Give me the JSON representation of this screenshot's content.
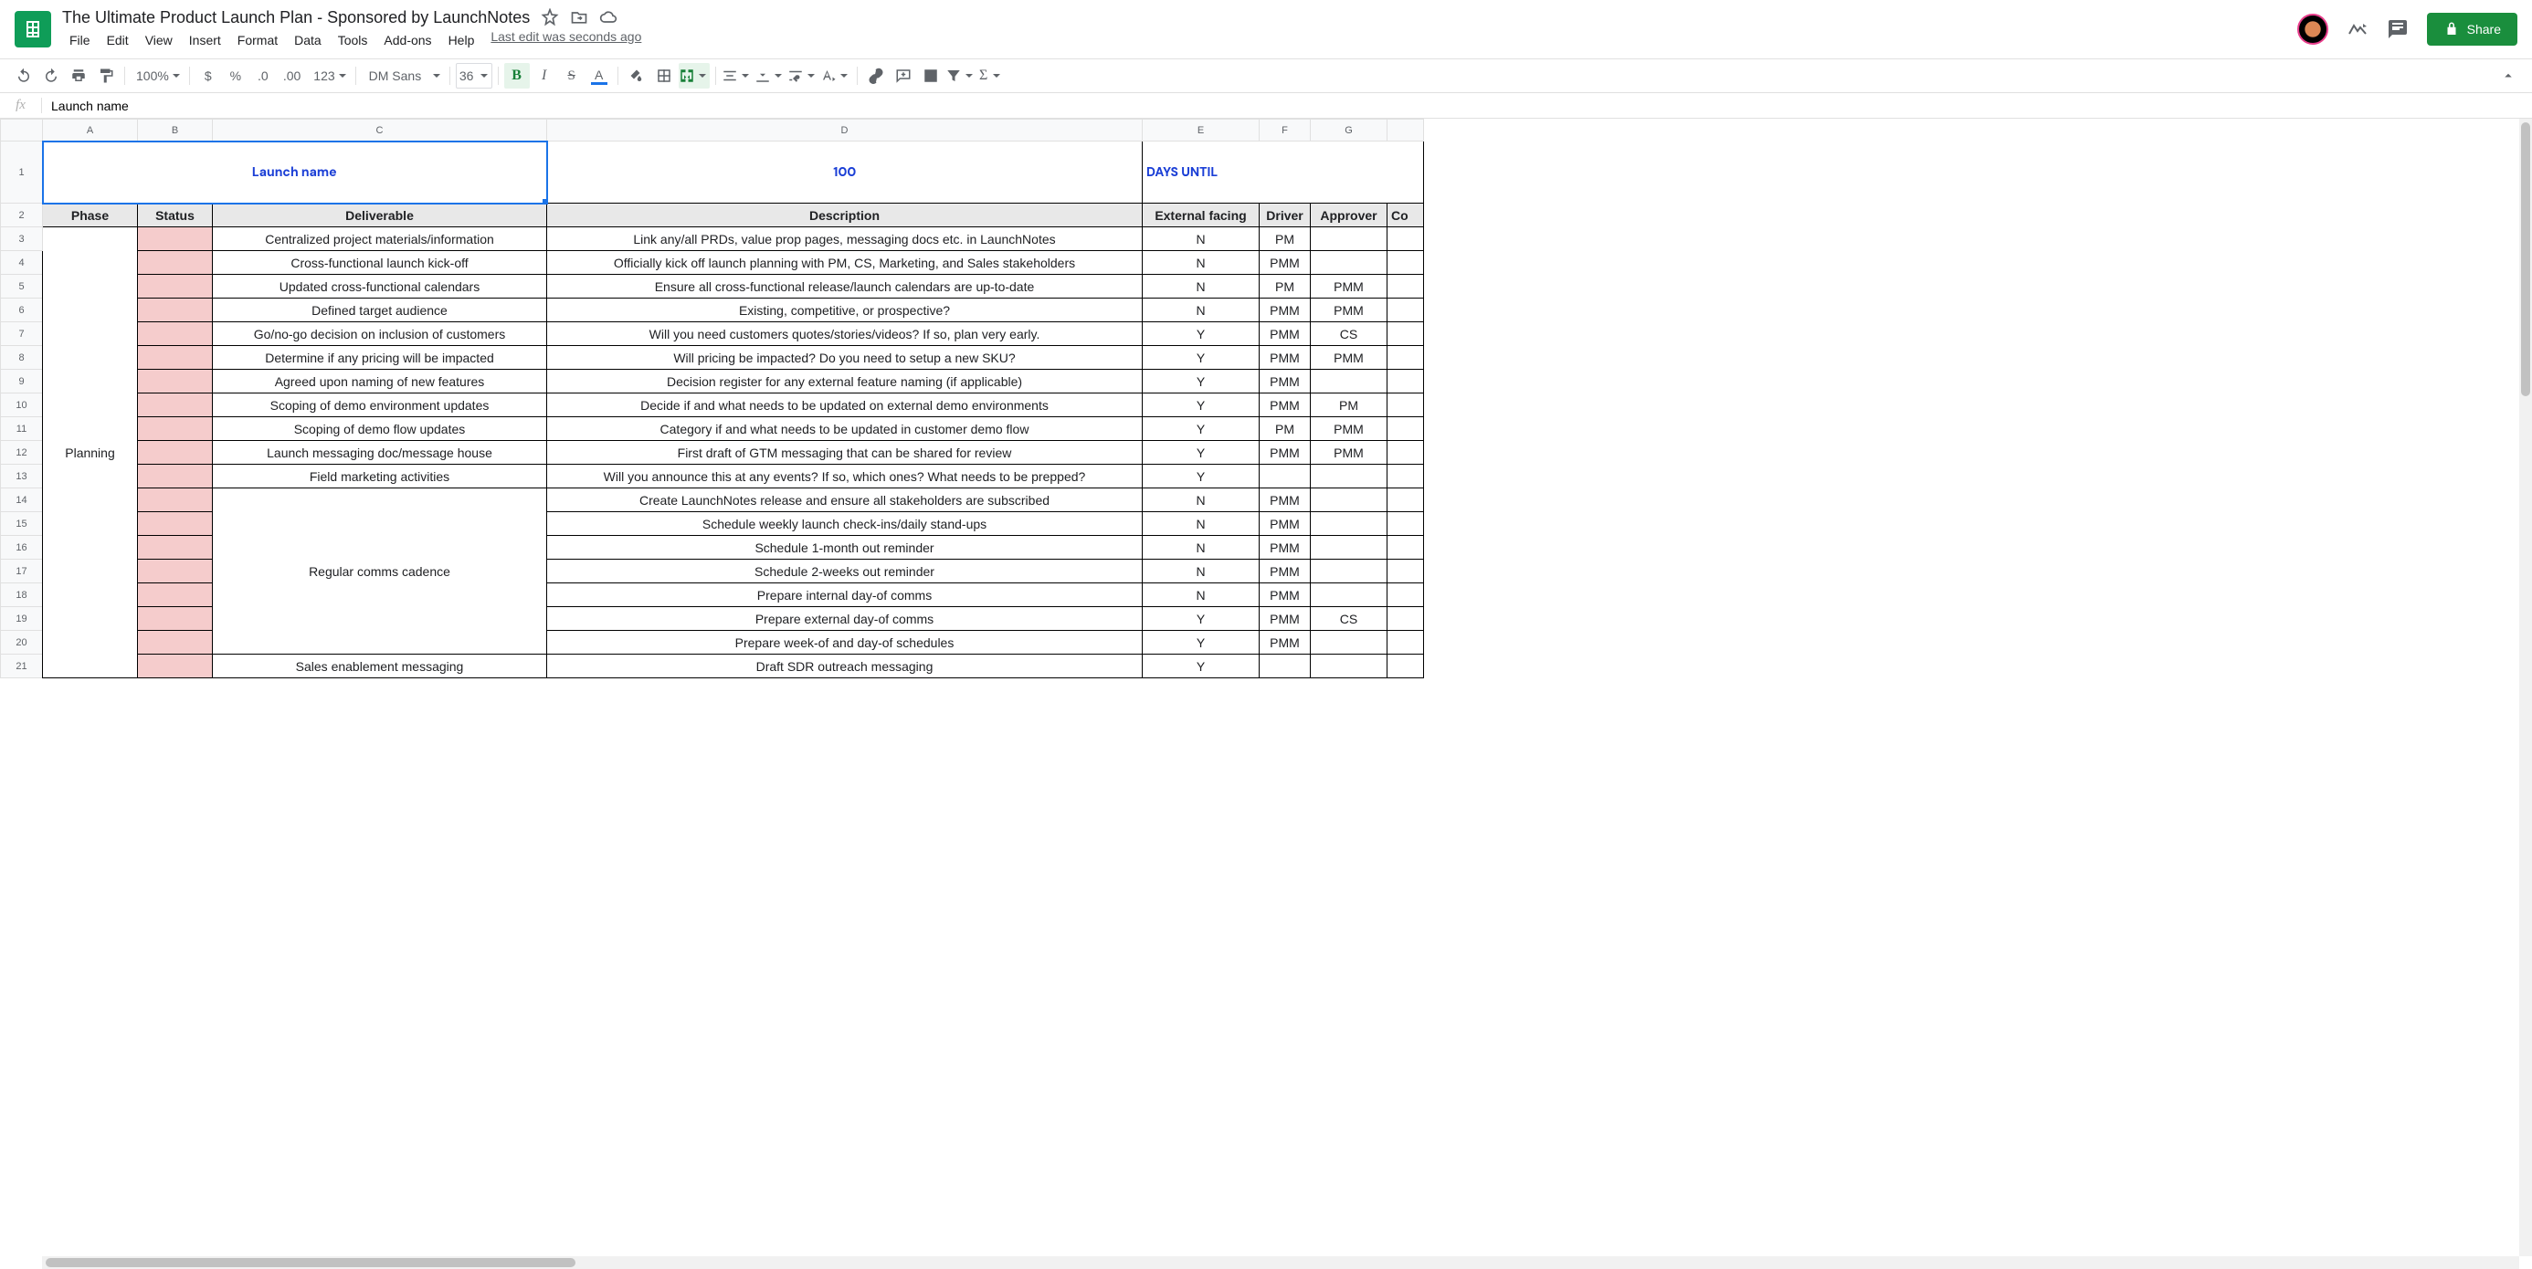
{
  "doc": {
    "title": "The Ultimate Product Launch Plan - Sponsored by LaunchNotes",
    "last_edit": "Last edit was seconds ago",
    "share": "Share"
  },
  "menu": [
    "File",
    "Edit",
    "View",
    "Insert",
    "Format",
    "Data",
    "Tools",
    "Add-ons",
    "Help"
  ],
  "toolbar": {
    "zoom": "100%",
    "currency": "$",
    "percent": "%",
    "dec_dec": ".0",
    "dec_inc": ".00",
    "numfmt": "123",
    "font": "DM Sans",
    "size": "36",
    "bold": "B",
    "italic": "I",
    "strike": "S",
    "textcolor_letter": "A",
    "sigma": "Σ"
  },
  "fx": {
    "value": "Launch name"
  },
  "columns": [
    "A",
    "B",
    "C",
    "D",
    "E",
    "F",
    "G"
  ],
  "row1": {
    "title": "Launch name",
    "days_value": "100",
    "days_label": "DAYS UNTIL"
  },
  "headers": {
    "phase": "Phase",
    "status": "Status",
    "deliverable": "Deliverable",
    "description": "Description",
    "external": "External facing",
    "driver": "Driver",
    "approver": "Approver",
    "co": "Co"
  },
  "phase_planning": "Planning",
  "reg_comms": "Regular comms cadence",
  "sales_enable": "Sales enablement messaging",
  "rows": [
    {
      "n": 3,
      "c": "Centralized project materials/information",
      "d": "Link any/all PRDs, value prop pages, messaging docs etc. in LaunchNotes",
      "e": "N",
      "f": "PM",
      "g": ""
    },
    {
      "n": 4,
      "c": "Cross-functional launch kick-off",
      "d": "Officially kick off launch planning with PM, CS, Marketing, and Sales stakeholders",
      "e": "N",
      "f": "PMM",
      "g": ""
    },
    {
      "n": 5,
      "c": "Updated cross-functional calendars",
      "d": "Ensure all cross-functional release/launch calendars are up-to-date",
      "e": "N",
      "f": "PM",
      "g": "PMM"
    },
    {
      "n": 6,
      "c": "Defined target audience",
      "d": "Existing, competitive, or prospective?",
      "e": "N",
      "f": "PMM",
      "g": "PMM"
    },
    {
      "n": 7,
      "c": "Go/no-go decision on inclusion of customers",
      "d": "Will you need customers quotes/stories/videos? If so, plan very early.",
      "e": "Y",
      "f": "PMM",
      "g": "CS"
    },
    {
      "n": 8,
      "c": "Determine if any pricing will be impacted",
      "d": "Will pricing be impacted? Do you need to setup a new SKU?",
      "e": "Y",
      "f": "PMM",
      "g": "PMM"
    },
    {
      "n": 9,
      "c": "Agreed upon naming of new features",
      "d": "Decision register for any external feature naming (if applicable)",
      "e": "Y",
      "f": "PMM",
      "g": ""
    },
    {
      "n": 10,
      "c": "Scoping of demo environment updates",
      "d": "Decide if and what needs to be updated on external demo environments",
      "e": "Y",
      "f": "PMM",
      "g": "PM"
    },
    {
      "n": 11,
      "c": "Scoping of demo flow updates",
      "d": "Category if and what needs to be updated in customer demo flow",
      "e": "Y",
      "f": "PM",
      "g": "PMM"
    },
    {
      "n": 12,
      "c": "Launch messaging doc/message house",
      "d": "First draft of GTM messaging that can be shared for review",
      "e": "Y",
      "f": "PMM",
      "g": "PMM"
    },
    {
      "n": 13,
      "c": "Field marketing activities",
      "d": "Will you announce this at any events? If so, which ones? What needs to be prepped?",
      "e": "Y",
      "f": "",
      "g": ""
    },
    {
      "n": 14,
      "c": "",
      "d": "Create LaunchNotes release and ensure all stakeholders are subscribed",
      "e": "N",
      "f": "PMM",
      "g": ""
    },
    {
      "n": 15,
      "c": "",
      "d": "Schedule weekly launch check-ins/daily stand-ups",
      "e": "N",
      "f": "PMM",
      "g": ""
    },
    {
      "n": 16,
      "c": "",
      "d": "Schedule 1-month out reminder",
      "e": "N",
      "f": "PMM",
      "g": ""
    },
    {
      "n": 17,
      "c": "",
      "d": "Schedule 2-weeks out reminder",
      "e": "N",
      "f": "PMM",
      "g": ""
    },
    {
      "n": 18,
      "c": "",
      "d": "Prepare internal day-of comms",
      "e": "N",
      "f": "PMM",
      "g": ""
    },
    {
      "n": 19,
      "c": "",
      "d": "Prepare external day-of comms",
      "e": "Y",
      "f": "PMM",
      "g": "CS"
    },
    {
      "n": 20,
      "c": "",
      "d": "Prepare week-of and day-of schedules",
      "e": "Y",
      "f": "PMM",
      "g": ""
    },
    {
      "n": 21,
      "c": "",
      "d": "Draft SDR outreach messaging",
      "e": "Y",
      "f": "",
      "g": ""
    }
  ]
}
